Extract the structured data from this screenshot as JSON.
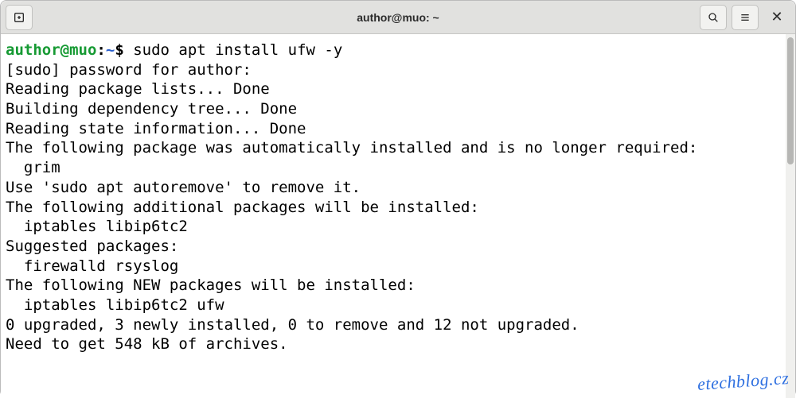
{
  "window": {
    "title": "author@muo: ~"
  },
  "prompt": {
    "user": "author",
    "at": "@",
    "host": "muo",
    "colon": ":",
    "path": "~",
    "symbol": "$ "
  },
  "command": "sudo apt install ufw -y",
  "output": {
    "l1": "[sudo] password for author:",
    "l2": "Reading package lists... Done",
    "l3": "Building dependency tree... Done",
    "l4": "Reading state information... Done",
    "l5": "The following package was automatically installed and is no longer required:",
    "l6": "  grim",
    "l7": "Use 'sudo apt autoremove' to remove it.",
    "l8": "The following additional packages will be installed:",
    "l9": "  iptables libip6tc2",
    "l10": "Suggested packages:",
    "l11": "  firewalld rsyslog",
    "l12": "The following NEW packages will be installed:",
    "l13": "  iptables libip6tc2 ufw",
    "l14": "0 upgraded, 3 newly installed, 0 to remove and 12 not upgraded.",
    "l15": "Need to get 548 kB of archives."
  },
  "watermark": "etechblog.cz"
}
